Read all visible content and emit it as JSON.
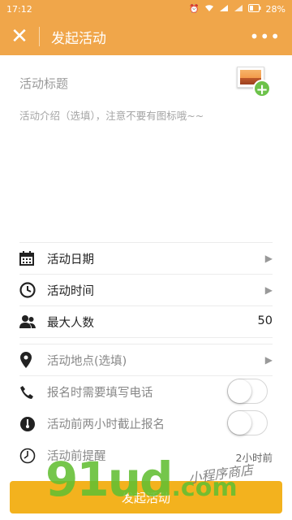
{
  "status_bar": {
    "time": "17:12",
    "battery": "28%"
  },
  "nav": {
    "close_glyph": "✕",
    "title": "发起活动",
    "more_glyph": "•••"
  },
  "form": {
    "title_placeholder": "活动标题",
    "intro_placeholder": "活动介绍（选填），注意不要有图标哦~~"
  },
  "rows": {
    "date": {
      "label": "活动日期",
      "icon": "calendar-icon"
    },
    "time": {
      "label": "活动时间",
      "icon": "clock-icon"
    },
    "max_people": {
      "label": "最大人数",
      "value": "50",
      "icon": "people-icon"
    },
    "location": {
      "label": "活动地点(选填)",
      "icon": "location-pin-icon"
    },
    "phone": {
      "label": "报名时需要填写电话",
      "icon": "phone-icon",
      "on": false
    },
    "deadline": {
      "label": "活动前两小时截止报名",
      "icon": "stopwatch-icon",
      "on": false
    },
    "reminder": {
      "label": "活动前提醒",
      "value": "2小时前",
      "icon": "alarm-clock-icon"
    }
  },
  "submit": {
    "label": "发起活动"
  },
  "watermark": {
    "left_text": "91ud",
    "left_suffix": ".com",
    "right_text": "小程序商店"
  },
  "colors": {
    "header": "#f0a64a",
    "button": "#f3b21e",
    "toggle_off_border": "#d6d6d6"
  }
}
